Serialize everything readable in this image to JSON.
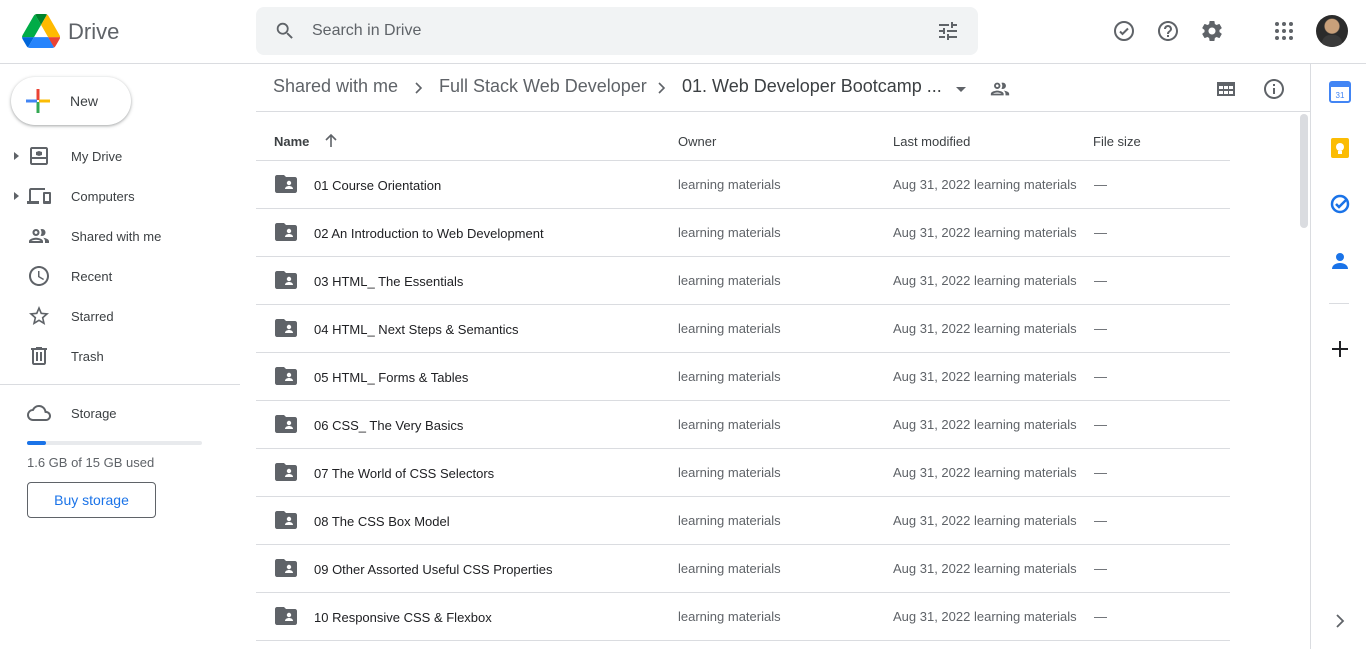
{
  "app": {
    "name": "Drive"
  },
  "search": {
    "placeholder": "Search in Drive"
  },
  "header": {
    "icons": [
      "ready-offline-icon",
      "help-icon",
      "settings-icon",
      "apps-icon",
      "account-avatar"
    ]
  },
  "sidebar": {
    "new_label": "New",
    "items": [
      {
        "label": "My Drive",
        "icon": "my-drive-icon"
      },
      {
        "label": "Computers",
        "icon": "computers-icon"
      },
      {
        "label": "Shared with me",
        "icon": "shared-icon"
      },
      {
        "label": "Recent",
        "icon": "clock-icon"
      },
      {
        "label": "Starred",
        "icon": "star-icon"
      },
      {
        "label": "Trash",
        "icon": "trash-icon"
      }
    ],
    "storage": {
      "label": "Storage",
      "used_text": "1.6 GB of 15 GB used",
      "fraction": 0.107,
      "buy_label": "Buy storage"
    }
  },
  "breadcrumb": {
    "items": [
      "Shared with me",
      "Full Stack Web Developer",
      "01. Web Developer Bootcamp ..."
    ]
  },
  "table": {
    "columns": {
      "name": "Name",
      "owner": "Owner",
      "modified": "Last modified",
      "size": "File size"
    },
    "rows": [
      {
        "name": "01 Course Orientation",
        "owner": "learning materials",
        "date": "Aug 31, 2022",
        "modified_by": "learning materials",
        "size": "—"
      },
      {
        "name": "02 An Introduction to Web Development",
        "owner": "learning materials",
        "date": "Aug 31, 2022",
        "modified_by": "learning materials",
        "size": "—"
      },
      {
        "name": "03 HTML_ The Essentials",
        "owner": "learning materials",
        "date": "Aug 31, 2022",
        "modified_by": "learning materials",
        "size": "—"
      },
      {
        "name": "04 HTML_ Next Steps & Semantics",
        "owner": "learning materials",
        "date": "Aug 31, 2022",
        "modified_by": "learning materials",
        "size": "—"
      },
      {
        "name": "05 HTML_ Forms & Tables",
        "owner": "learning materials",
        "date": "Aug 31, 2022",
        "modified_by": "learning materials",
        "size": "—"
      },
      {
        "name": "06 CSS_ The Very Basics",
        "owner": "learning materials",
        "date": "Aug 31, 2022",
        "modified_by": "learning materials",
        "size": "—"
      },
      {
        "name": "07 The World of CSS Selectors",
        "owner": "learning materials",
        "date": "Aug 31, 2022",
        "modified_by": "learning materials",
        "size": "—"
      },
      {
        "name": "08 The CSS Box Model",
        "owner": "learning materials",
        "date": "Aug 31, 2022",
        "modified_by": "learning materials",
        "size": "—"
      },
      {
        "name": "09 Other Assorted Useful CSS Properties",
        "owner": "learning materials",
        "date": "Aug 31, 2022",
        "modified_by": "learning materials",
        "size": "—"
      },
      {
        "name": "10 Responsive CSS & Flexbox",
        "owner": "learning materials",
        "date": "Aug 31, 2022",
        "modified_by": "learning materials",
        "size": "—"
      }
    ]
  },
  "side_panel": {
    "icons": [
      "calendar-icon",
      "keep-icon",
      "tasks-icon",
      "contacts-icon",
      "add-addon-icon",
      "expand-panel-icon"
    ],
    "calendar_day": "31"
  },
  "colors": {
    "accent": "#1a73e8",
    "text": "#3c4043",
    "muted": "#5f6368",
    "border": "#dadce0"
  }
}
